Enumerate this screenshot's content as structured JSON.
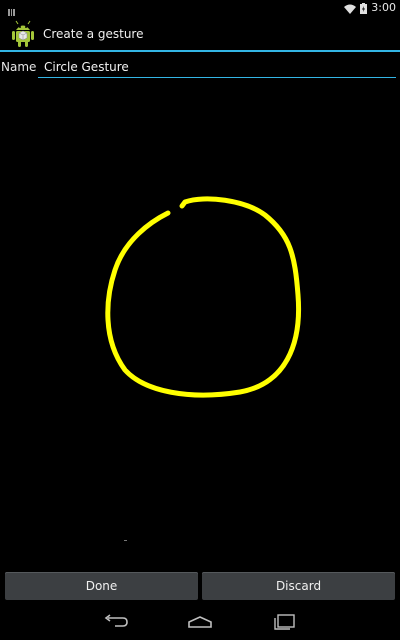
{
  "status_bar": {
    "time": "3:00",
    "icons": [
      "notification-icon",
      "wifi-icon",
      "battery-icon"
    ]
  },
  "action_bar": {
    "title": "Create a gesture",
    "app_icon": "android-icon"
  },
  "form": {
    "name_label": "Name",
    "name_value": "Circle Gesture"
  },
  "gesture": {
    "stroke_color": "#ffff00"
  },
  "buttons": {
    "done_label": "Done",
    "discard_label": "Discard"
  },
  "nav_bar": {
    "icons": [
      "back-icon",
      "home-icon",
      "recent-apps-icon"
    ]
  },
  "colors": {
    "accent": "#33b5e5",
    "background": "#000000",
    "button": "#3c3f42"
  }
}
